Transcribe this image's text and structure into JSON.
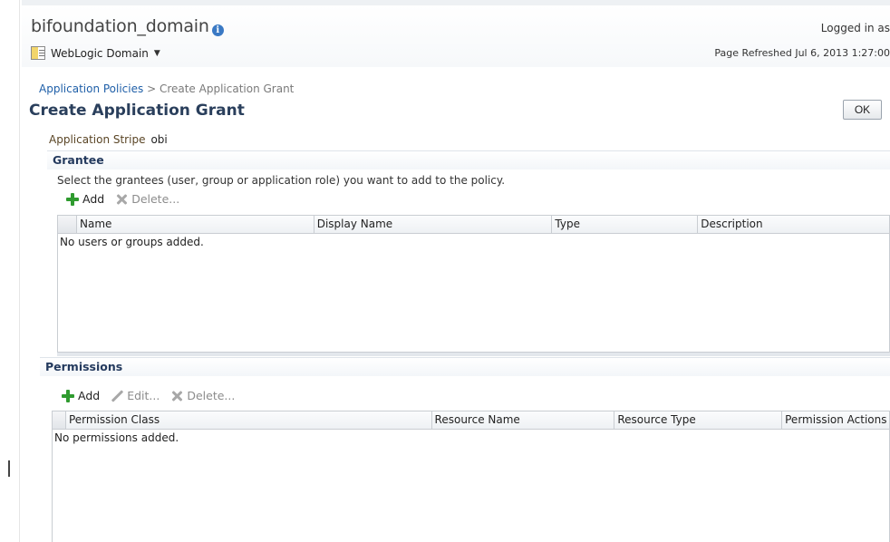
{
  "header": {
    "domain_title": "bifoundation_domain",
    "menu_label": "WebLogic Domain",
    "logged_in": "Logged in as",
    "refreshed": "Page Refreshed Jul 6, 2013 1:27:00"
  },
  "breadcrumb": {
    "link": "Application Policies",
    "separator": " > ",
    "current": "Create Application Grant"
  },
  "page": {
    "title": "Create Application Grant",
    "ok_label": "OK",
    "stripe_label": "Application Stripe",
    "stripe_value": "obi"
  },
  "grantee": {
    "title": "Grantee",
    "description": "Select the grantees (user, group or application role) you want to add to the policy.",
    "add_label": "Add",
    "delete_label": "Delete...",
    "columns": [
      "Name",
      "Display Name",
      "Type",
      "Description"
    ],
    "empty_text": "No users or groups added."
  },
  "permissions": {
    "title": "Permissions",
    "add_label": "Add",
    "edit_label": "Edit...",
    "delete_label": "Delete...",
    "columns": [
      "Permission Class",
      "Resource Name",
      "Resource Type",
      "Permission Actions"
    ],
    "empty_text": "No permissions added."
  },
  "icons": {
    "info": "info-icon",
    "domain": "weblogic-domain-icon",
    "add": "add-icon",
    "delete": "delete-icon",
    "edit": "edit-icon"
  },
  "colors": {
    "title_blue": "#2a3f5c",
    "link_blue": "#1f5fa8",
    "add_green": "#2f9b2f"
  }
}
